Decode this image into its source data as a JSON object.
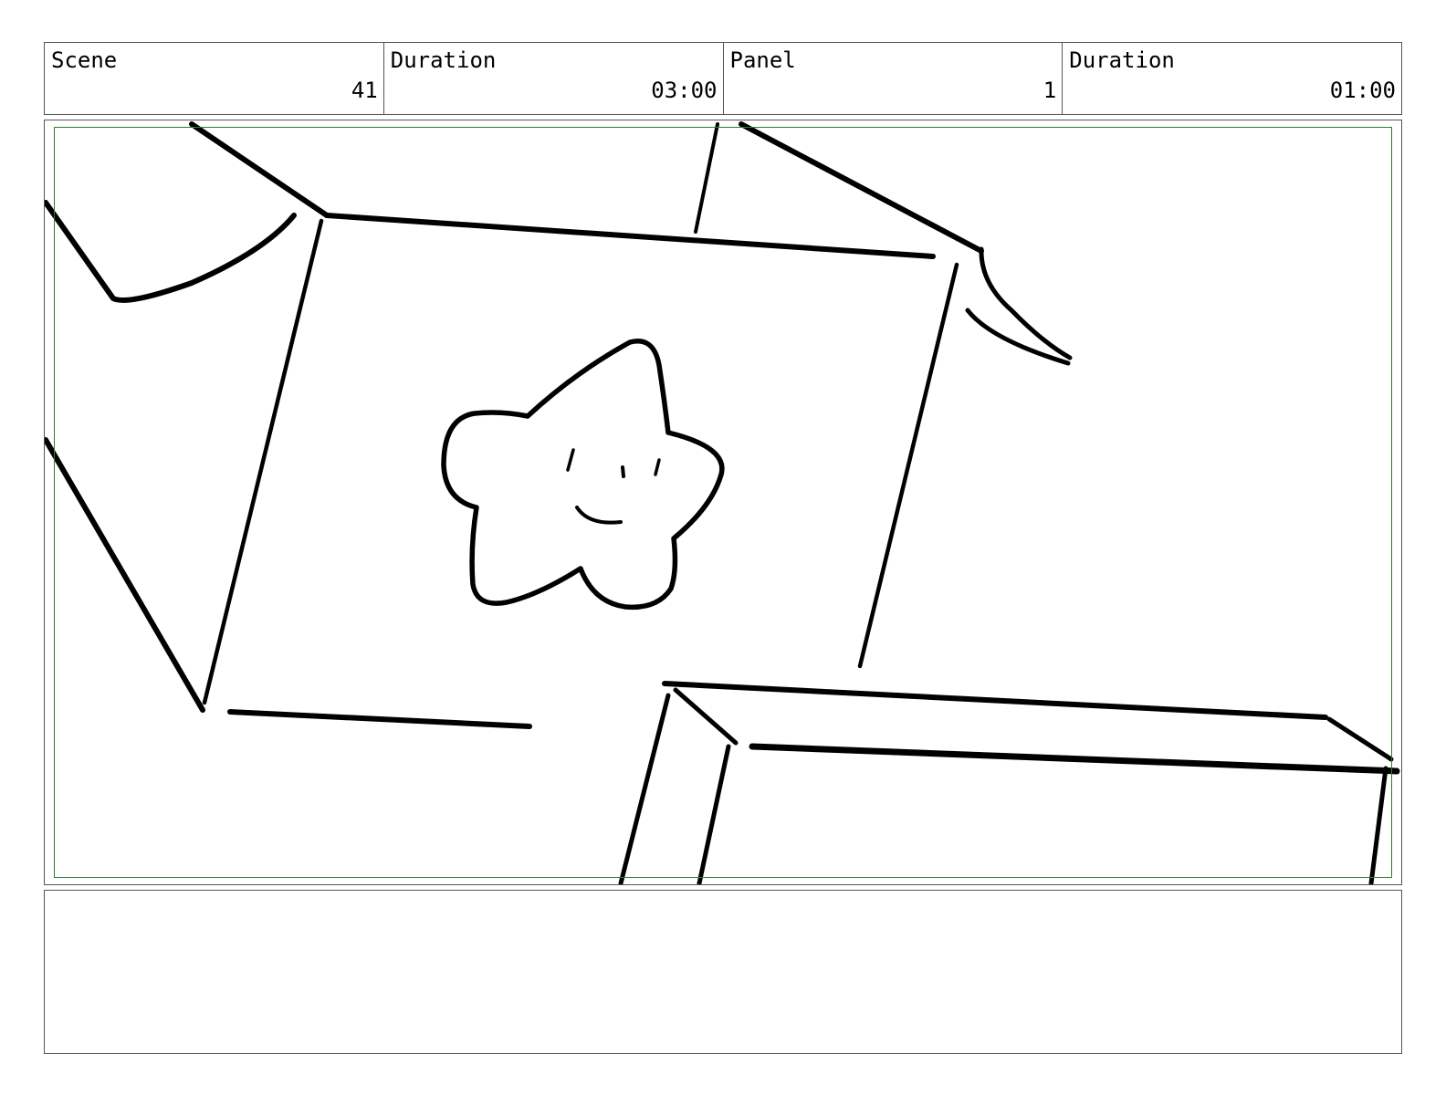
{
  "header": {
    "scene_label": "Scene",
    "scene_value": "41",
    "scene_duration_label": "Duration",
    "scene_duration_value": "03:00",
    "panel_label": "Panel",
    "panel_value": "1",
    "panel_duration_label": "Duration",
    "panel_duration_value": "01:00"
  },
  "panel": {
    "safe_area_color": "#2e7d32",
    "line_color": "#000000",
    "subject": "star-doodle"
  },
  "notes": {
    "text": ""
  }
}
